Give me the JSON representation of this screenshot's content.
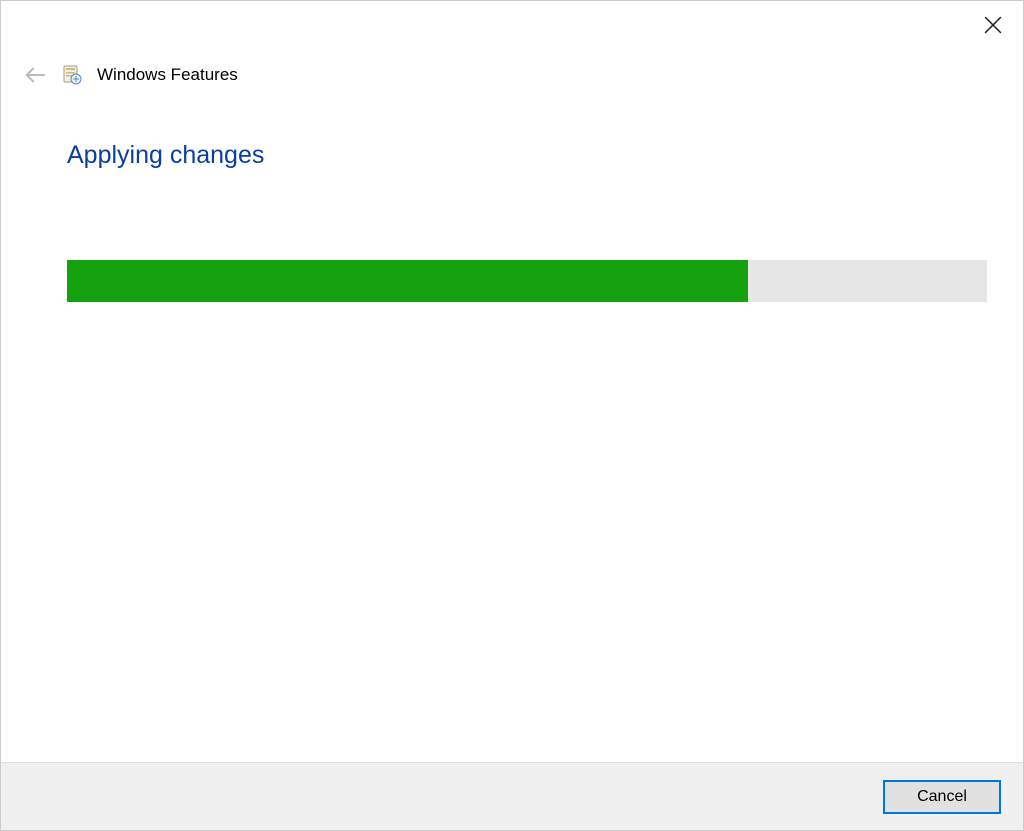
{
  "window": {
    "title": "Windows Features"
  },
  "content": {
    "heading": "Applying changes",
    "progress_percent": 74
  },
  "footer": {
    "cancel_label": "Cancel"
  },
  "colors": {
    "heading": "#0a3f9c",
    "progress_fill": "#13a10e",
    "progress_track": "#e6e6e6",
    "button_focus_border": "#0078d7"
  }
}
